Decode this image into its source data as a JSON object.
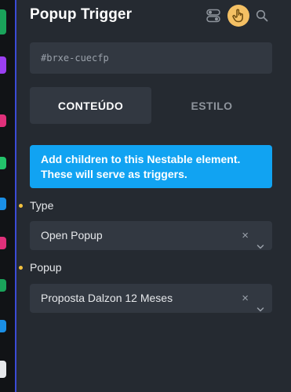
{
  "header": {
    "title": "Popup Trigger",
    "icons": [
      "toggle-icon",
      "hand-pointer-icon",
      "search-icon"
    ]
  },
  "element_id": "#brxe-cuecfp",
  "tabs": [
    {
      "label": "CONTEÚDO",
      "active": true
    },
    {
      "label": "ESTILO",
      "active": false
    }
  ],
  "notice": "Add children to this Nestable element. These will serve as triggers.",
  "controls": [
    {
      "label": "Type",
      "value": "Open Popup"
    },
    {
      "label": "Popup",
      "value": "Proposta Dalzon 12 Meses"
    }
  ],
  "colors": {
    "panel_bg": "#252a31",
    "field_bg": "#323841",
    "notice_bg": "#11a3f2",
    "accent_yellow": "#f4c064",
    "bullet": "#f4c23f",
    "border_accent": "#3b4bd6"
  }
}
